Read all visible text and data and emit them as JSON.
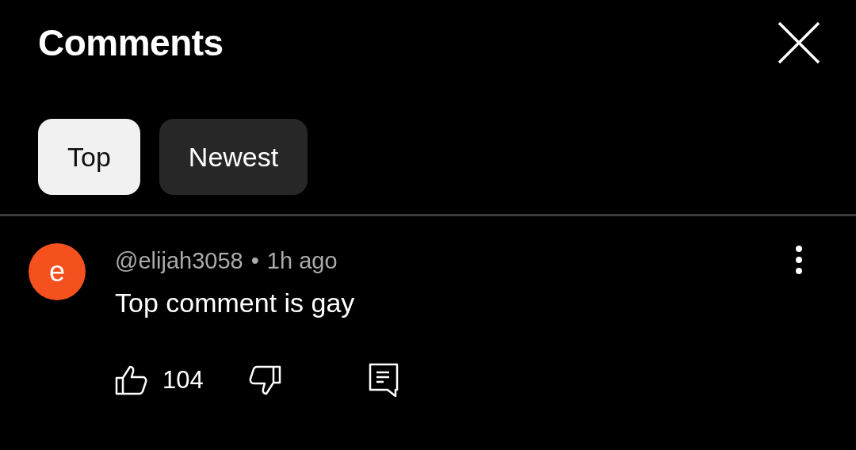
{
  "header": {
    "title": "Comments"
  },
  "filters": [
    {
      "label": "Top",
      "selected": true
    },
    {
      "label": "Newest",
      "selected": false
    }
  ],
  "comments": [
    {
      "avatar_letter": "e",
      "color": "#f4511e",
      "author": "@elijah3058",
      "separator": "•",
      "time": "1h ago",
      "text": "Top comment is gay",
      "likes": "104"
    }
  ]
}
